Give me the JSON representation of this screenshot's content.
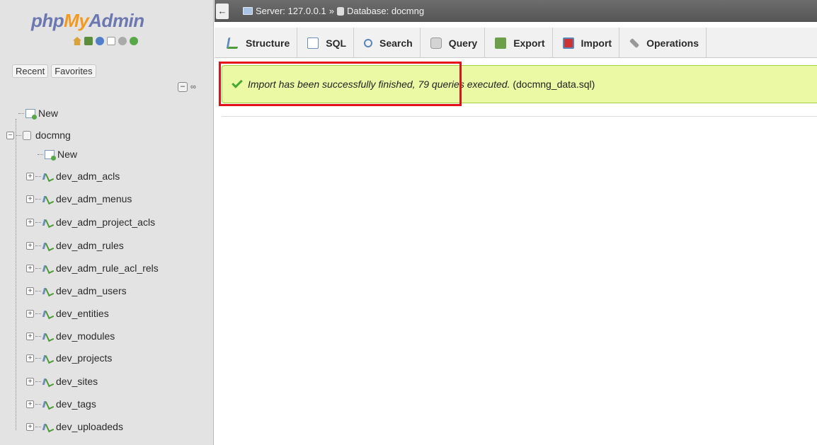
{
  "logo": {
    "part1": "php",
    "part2": "My",
    "part3": "Admin"
  },
  "quick_icons": [
    "home-icon",
    "exit-icon",
    "help-icon",
    "docs-icon",
    "settings-icon",
    "reload-icon"
  ],
  "sidebar": {
    "recent_label": "Recent",
    "favorites_label": "Favorites",
    "collapse_symbol": "–",
    "link_symbol": "∞",
    "root_new": "New",
    "database": "docmng",
    "db_new": "New",
    "tables": [
      "dev_adm_acls",
      "dev_adm_menus",
      "dev_adm_project_acls",
      "dev_adm_rules",
      "dev_adm_rule_acl_rels",
      "dev_adm_users",
      "dev_entities",
      "dev_modules",
      "dev_projects",
      "dev_sites",
      "dev_tags",
      "dev_uploadeds"
    ]
  },
  "breadcrumb": {
    "back_symbol": "←",
    "server": "Server: 127.0.0.1",
    "separator": "»",
    "database": "Database: docmng"
  },
  "tabs": [
    "Structure",
    "SQL",
    "Search",
    "Query",
    "Export",
    "Import",
    "Operations"
  ],
  "notice": {
    "message_italic": "Import has been successfully finished, 79 queries executed.",
    "file": "(docmng_data.sql)"
  }
}
